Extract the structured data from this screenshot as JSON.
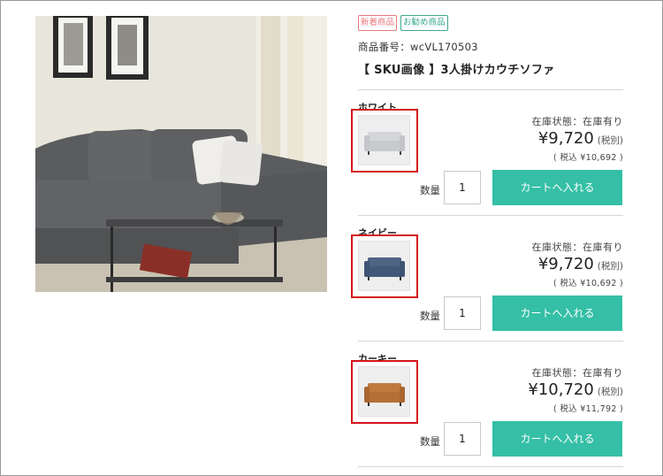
{
  "product": {
    "badges": [
      {
        "label": "新着商品",
        "color": "#e8797f"
      },
      {
        "label": "お勧め商品",
        "color": "#3aa88e"
      }
    ],
    "sku_line": "商品番号：wcVL170503",
    "title": "【 SKU画像 】3人掛けカウチソファ"
  },
  "variants": [
    {
      "name": "ホワイト",
      "stock": "在庫状態：在庫有り",
      "price": "¥9,720",
      "tax_note": "(税別)",
      "tax_in": "( 税込 ¥10,692 )",
      "qty_label": "数量",
      "qty_value": "1",
      "cart_label": "カートへ入れる",
      "swatch": "#d3d5d8"
    },
    {
      "name": "ネイビー",
      "stock": "在庫状態：在庫有り",
      "price": "¥9,720",
      "tax_note": "(税別)",
      "tax_in": "( 税込 ¥10,692 )",
      "qty_label": "数量",
      "qty_value": "1",
      "cart_label": "カートへ入れる",
      "swatch": "#4d6482"
    },
    {
      "name": "カーキー",
      "stock": "在庫状態：在庫有り",
      "price": "¥10,720",
      "tax_note": "(税別)",
      "tax_in": "( 税込 ¥11,792 )",
      "qty_label": "数量",
      "qty_value": "1",
      "cart_label": "カートへ入れる",
      "swatch": "#c07a3e"
    }
  ],
  "colors": {
    "accent": "#35bfa6",
    "highlight": "#d4141b"
  }
}
